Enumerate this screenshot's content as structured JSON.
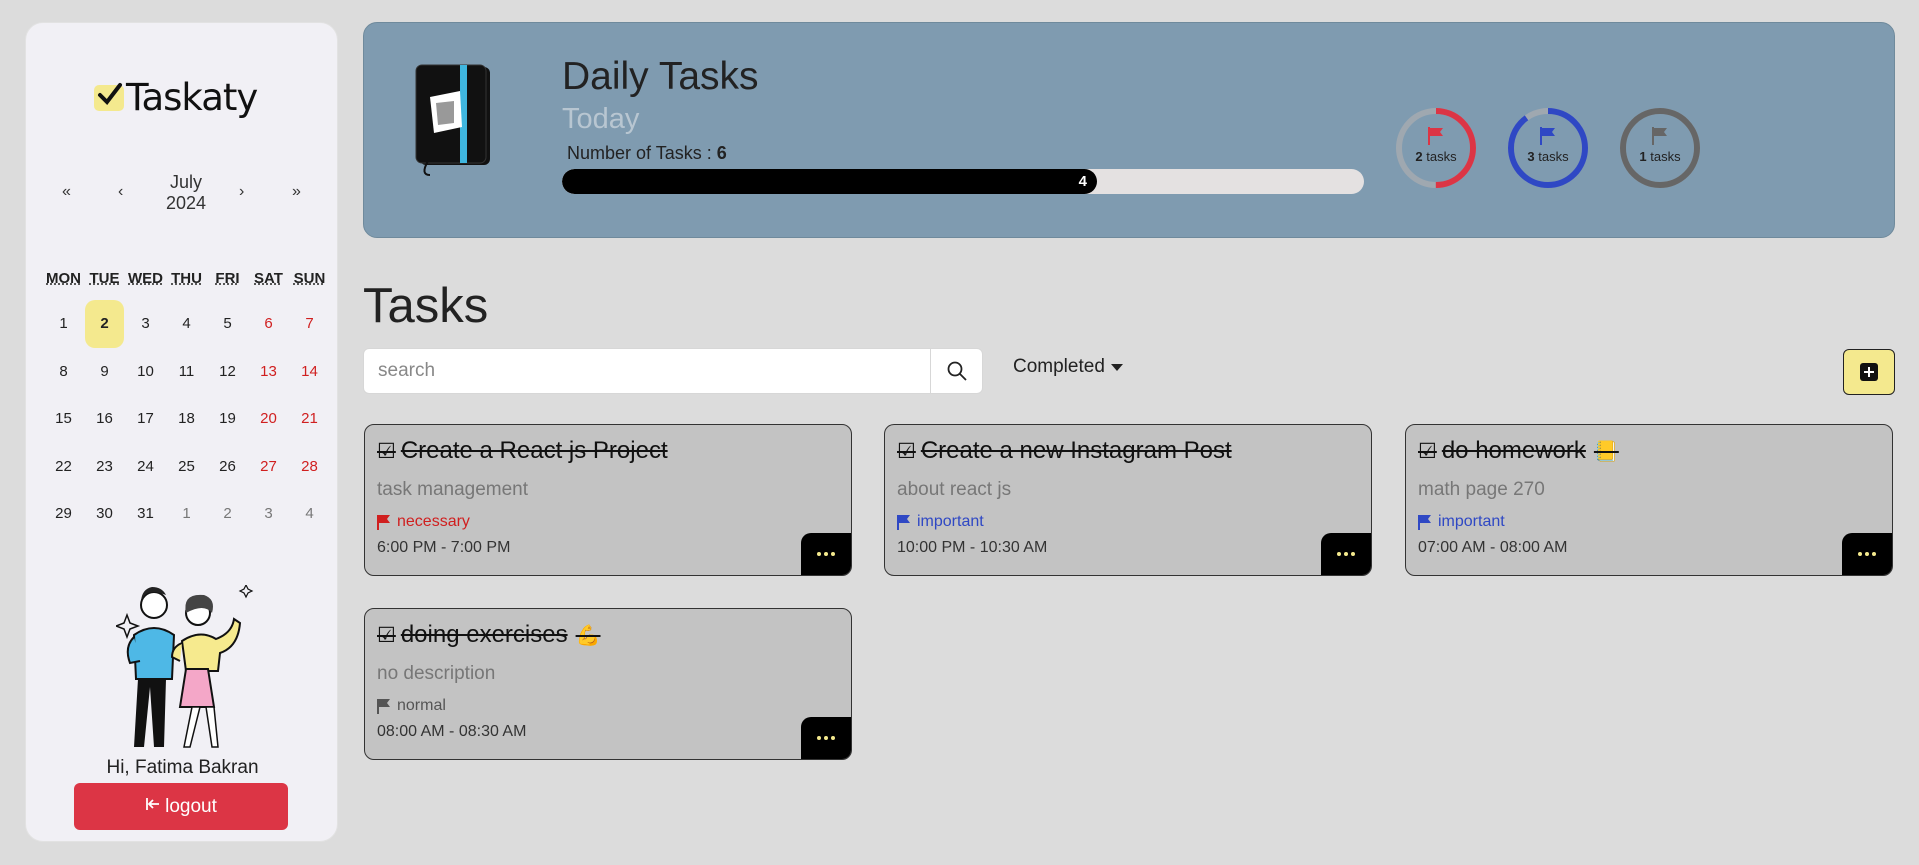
{
  "sidebar": {
    "logo_text": "Taskaty",
    "calendar": {
      "prev_year": "«",
      "prev_month": "‹",
      "month": "July",
      "year": "2024",
      "next_month": "›",
      "next_year": "»",
      "weekdays": [
        "MON",
        "TUE",
        "WED",
        "THU",
        "FRI",
        "SAT",
        "SUN"
      ],
      "days": [
        "1",
        "2",
        "3",
        "4",
        "5",
        "6",
        "7",
        "8",
        "9",
        "10",
        "11",
        "12",
        "13",
        "14",
        "15",
        "16",
        "17",
        "18",
        "19",
        "20",
        "21",
        "22",
        "23",
        "24",
        "25",
        "26",
        "27",
        "28",
        "29",
        "30",
        "31",
        "1",
        "2",
        "3",
        "4"
      ],
      "selected_day": "2"
    },
    "greeting": "Hi, Fatima Bakran",
    "logout_label": "logout",
    "logout_icon": "↵"
  },
  "banner": {
    "title": "Daily Tasks",
    "subtitle": "Today",
    "num_tasks_label": "Number of Tasks :",
    "num_tasks": "6",
    "progress_value": "4",
    "progress_fraction": 0.667,
    "rings": [
      {
        "count": "2",
        "unit": "tasks",
        "color": "#dc3545",
        "fraction": 0.5
      },
      {
        "count": "3",
        "unit": "tasks",
        "color": "#2f48c4",
        "fraction": 0.9
      },
      {
        "count": "1",
        "unit": "tasks",
        "color": "#666666",
        "fraction": 1.0
      }
    ]
  },
  "tasks": {
    "title": "Tasks",
    "search_placeholder": "search",
    "filter_label": "Completed",
    "cards": [
      {
        "title": "Create a React js Project",
        "emoji": "",
        "desc": "task management",
        "priority": "necessary",
        "priority_color": "#d01f1f",
        "time": "6:00 PM - 7:00 PM"
      },
      {
        "title": "Create a new Instagram Post",
        "emoji": "",
        "desc": "about react js",
        "priority": "important",
        "priority_color": "#2f48c4",
        "time": "10:00 PM - 10:30 AM"
      },
      {
        "title": "do homework",
        "emoji": "📒",
        "desc": "math page 270",
        "priority": "important",
        "priority_color": "#2f48c4",
        "time": "07:00 AM - 08:00 AM"
      },
      {
        "title": "doing exercises",
        "emoji": "💪",
        "desc": "no description",
        "priority": "normal",
        "priority_color": "#555555",
        "time": "08:00 AM - 08:30 AM"
      }
    ]
  }
}
